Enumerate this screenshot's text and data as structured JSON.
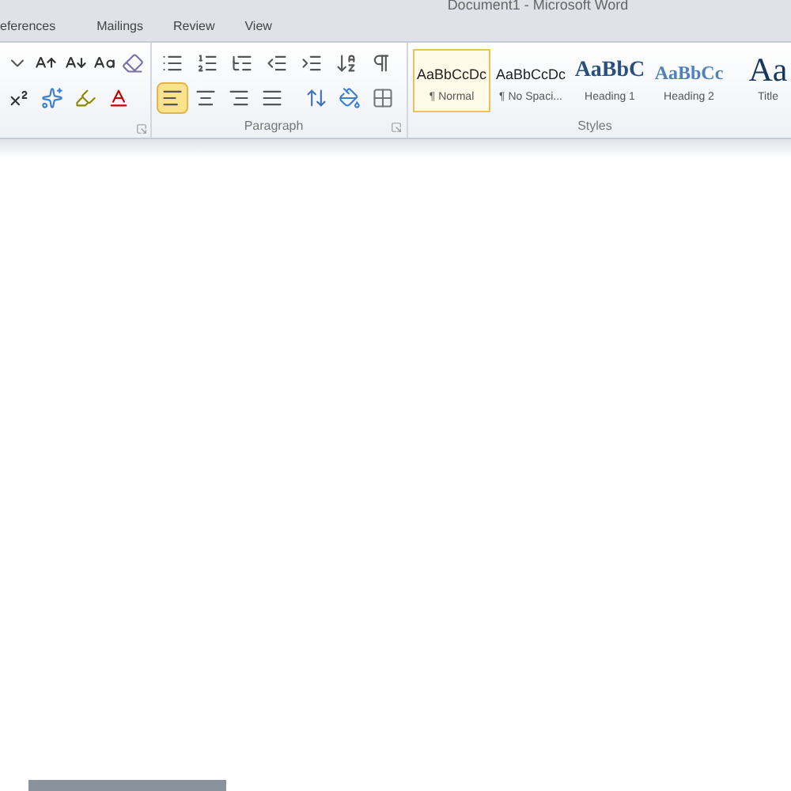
{
  "window": {
    "title": "Document1 - Microsoft Word"
  },
  "tabs": [
    {
      "label": "eferences",
      "selected": false
    },
    {
      "label": "Mailings",
      "selected": false
    },
    {
      "label": "Review",
      "selected": false
    },
    {
      "label": "View",
      "selected": false
    }
  ],
  "font_group": {
    "row1": [
      {
        "kind": "caret"
      },
      {
        "kind": "grow"
      },
      {
        "kind": "shrink"
      },
      {
        "kind": "case"
      },
      {
        "kind": "clear"
      }
    ],
    "row2": [
      {
        "kind": "superscript"
      },
      {
        "kind": "effects"
      },
      {
        "kind": "highlight"
      },
      {
        "kind": "color"
      }
    ]
  },
  "paragraph_group": {
    "label": "Paragraph",
    "row1": [
      {
        "kind": "bullets"
      },
      {
        "kind": "numbering"
      },
      {
        "kind": "multilevel"
      },
      {
        "kind": "outdent"
      },
      {
        "kind": "indent"
      },
      {
        "kind": "sort"
      },
      {
        "kind": "pilcrow"
      }
    ],
    "alignment": [
      {
        "kind": "left",
        "selected": true
      },
      {
        "kind": "center",
        "selected": false
      },
      {
        "kind": "right",
        "selected": false
      },
      {
        "kind": "justify",
        "selected": false
      }
    ],
    "row2": [
      {
        "kind": "spacing"
      },
      {
        "kind": "shading"
      },
      {
        "kind": "borders"
      }
    ]
  },
  "styles_group": {
    "label": "Styles",
    "items": [
      {
        "preview": "AaBbCcDc",
        "name": "¶ Normal",
        "kind": "body",
        "selected": true
      },
      {
        "preview": "AaBbCcDc",
        "name": "¶ No Spaci...",
        "kind": "body",
        "selected": false
      },
      {
        "preview": "AaBbC",
        "name": "Heading 1",
        "kind": "heading1",
        "selected": false
      },
      {
        "preview": "AaBbCc",
        "name": "Heading 2",
        "kind": "heading2",
        "selected": false
      },
      {
        "preview": "Aa",
        "name": "Title",
        "kind": "title",
        "selected": false
      }
    ]
  }
}
